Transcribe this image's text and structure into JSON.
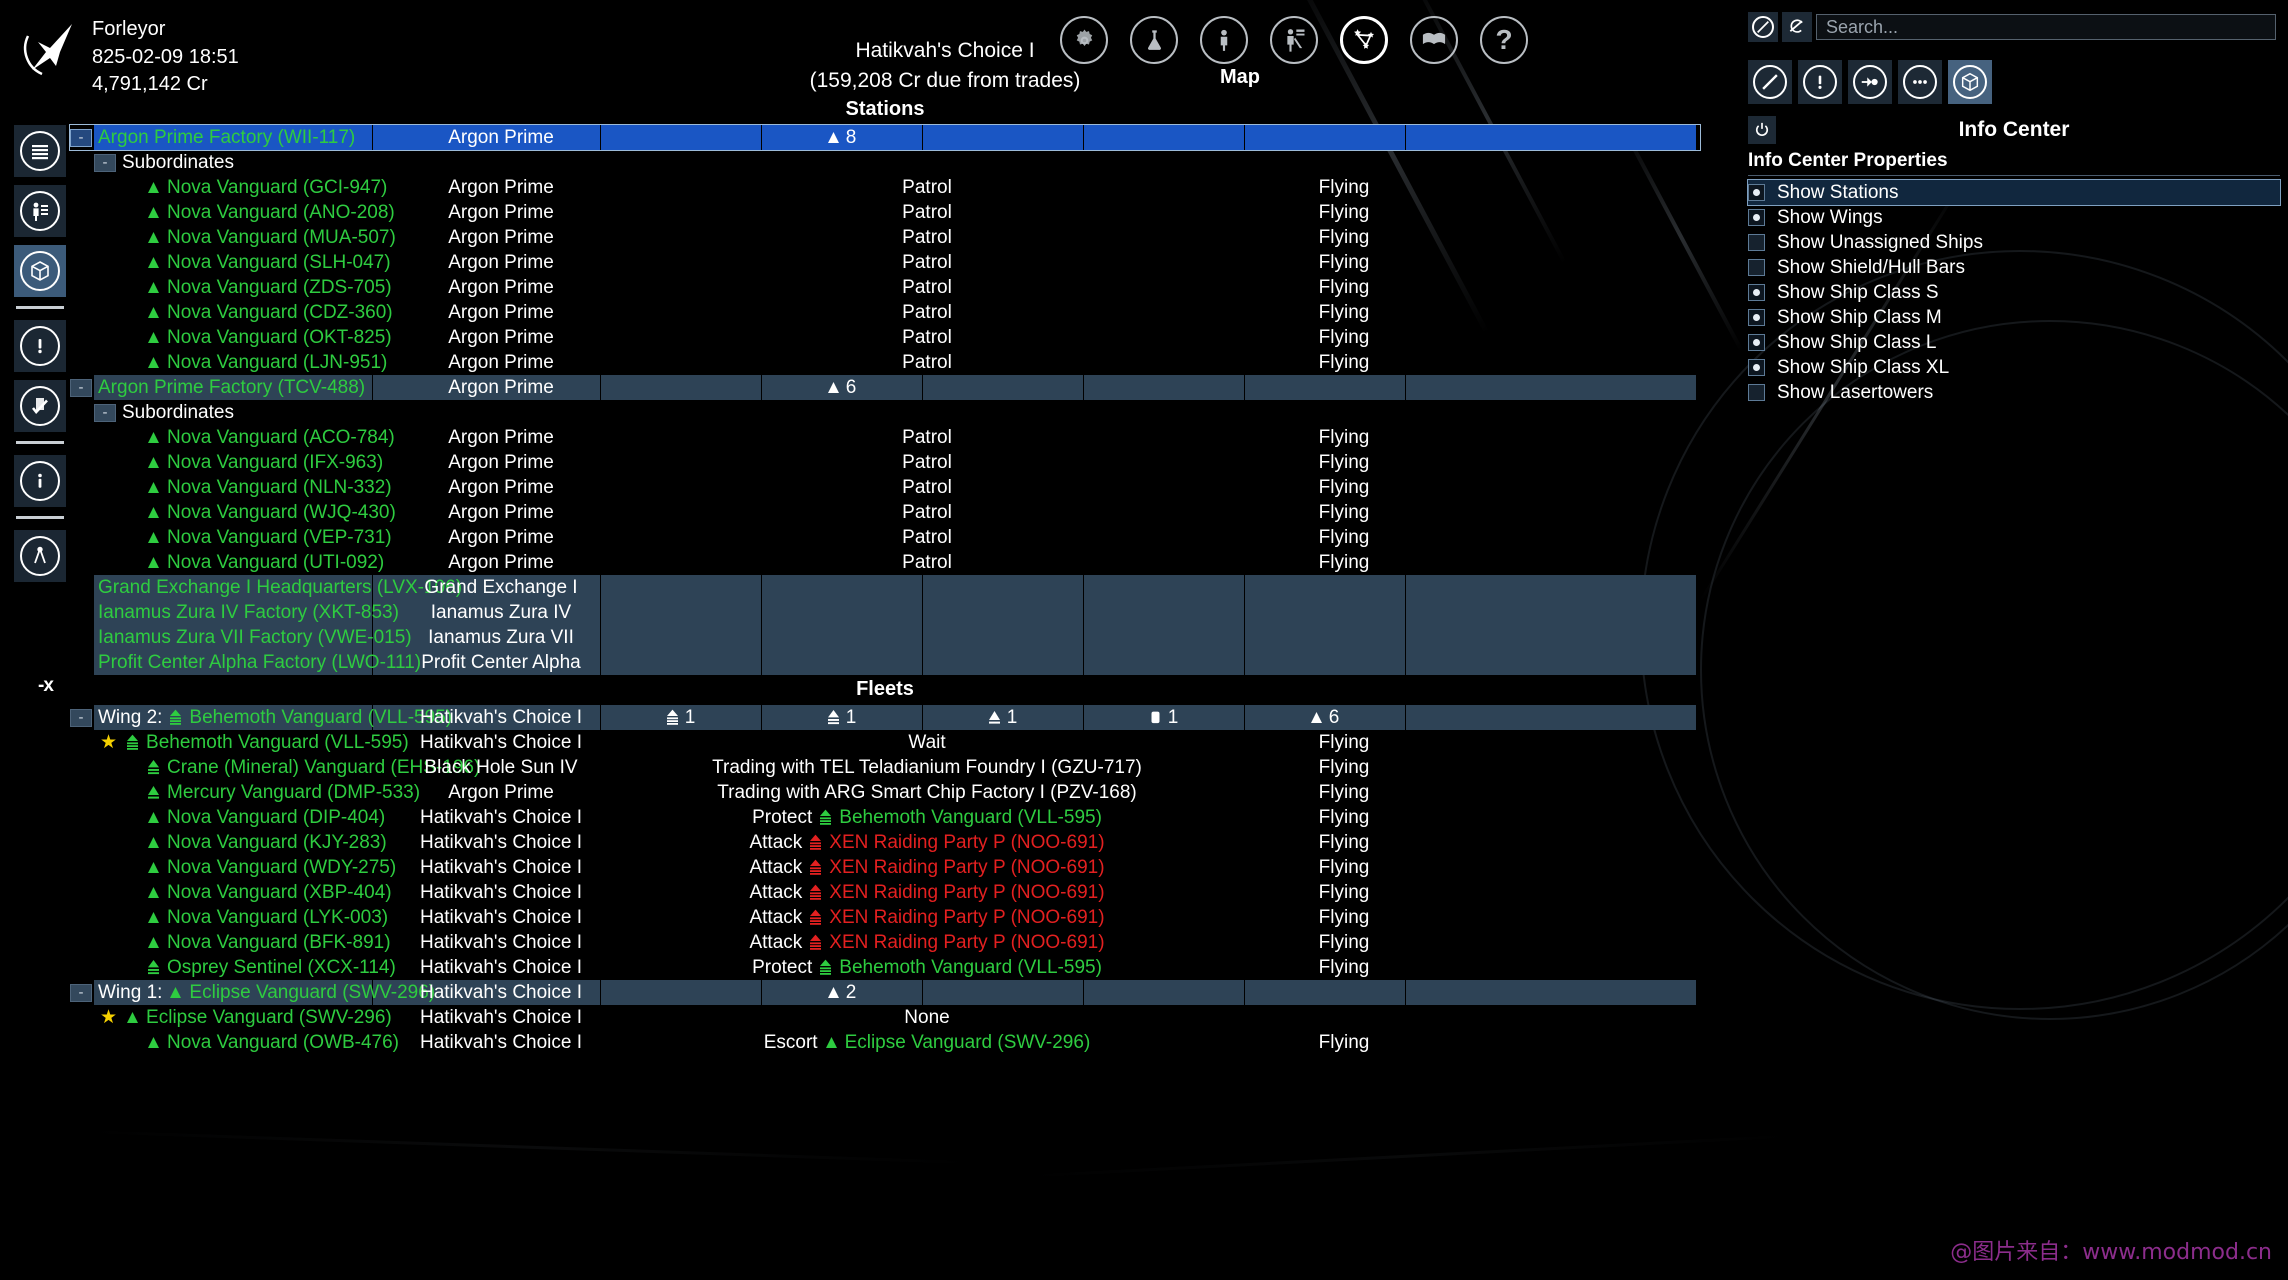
{
  "topbar": {
    "player_name": "Forleyor",
    "date": "825-02-09 18:51",
    "credits": "4,791,142 Cr",
    "sector_name": "Hatikvah's Choice I",
    "sector_sub": "(159,208 Cr due from trades)",
    "active_label": "Map",
    "icons": [
      {
        "name": "gear-icon",
        "label": "Settings",
        "active": false
      },
      {
        "name": "flask-icon",
        "label": "Research",
        "active": false
      },
      {
        "name": "person-icon",
        "label": "Player Info",
        "active": false
      },
      {
        "name": "crew-icon",
        "label": "Empire",
        "active": false
      },
      {
        "name": "map-constellation-icon",
        "label": "Map",
        "active": true
      },
      {
        "name": "book-icon",
        "label": "Encyclopedia",
        "active": false
      },
      {
        "name": "help-question-icon",
        "label": "Help",
        "active": false
      }
    ]
  },
  "left_rail": [
    {
      "name": "sidebar-item-object-list",
      "icon": "list-lines-icon",
      "active": false
    },
    {
      "name": "sidebar-item-personnel",
      "icon": "personnel-icon",
      "active": false
    },
    {
      "name": "sidebar-item-info-center",
      "icon": "cube-icon",
      "active": true
    },
    {
      "separator": true
    },
    {
      "name": "sidebar-item-alerts",
      "icon": "alert-exclamation-icon",
      "active": false
    },
    {
      "name": "sidebar-item-missions",
      "icon": "clipboard-check-icon",
      "active": false
    },
    {
      "separator": true
    },
    {
      "name": "sidebar-item-info",
      "icon": "info-i-icon",
      "active": false
    },
    {
      "separator": true
    },
    {
      "name": "sidebar-item-measure",
      "icon": "compass-divider-icon",
      "active": false
    }
  ],
  "table": {
    "stations_header": "Stations",
    "fleets_header": "Fleets",
    "close_tab_label": "-x",
    "subordinates_label": "Subordinates",
    "stations": [
      {
        "kind": "station",
        "expander": "-",
        "indent": 0,
        "name": "Argon Prime Factory (WII-117)",
        "sector": "Argon Prime",
        "counts": [
          {
            "icon": "ship-s-icon",
            "value": "8"
          }
        ],
        "count_col": 2,
        "order": "",
        "status": "",
        "style": "highlight"
      },
      {
        "kind": "group",
        "expander": "-",
        "indent": 1,
        "name": "Subordinates",
        "sector": "",
        "order": "",
        "status": "",
        "style": "plain"
      },
      {
        "kind": "ship",
        "indent": 2,
        "icon": "ship-s-icon",
        "name": "Nova Vanguard (GCI-947)",
        "sector": "Argon Prime",
        "order": "Patrol",
        "status": "Flying",
        "style": "plain"
      },
      {
        "kind": "ship",
        "indent": 2,
        "icon": "ship-s-icon",
        "name": "Nova Vanguard (ANO-208)",
        "sector": "Argon Prime",
        "order": "Patrol",
        "status": "Flying",
        "style": "plain"
      },
      {
        "kind": "ship",
        "indent": 2,
        "icon": "ship-s-icon",
        "name": "Nova Vanguard (MUA-507)",
        "sector": "Argon Prime",
        "order": "Patrol",
        "status": "Flying",
        "style": "plain"
      },
      {
        "kind": "ship",
        "indent": 2,
        "icon": "ship-s-icon",
        "name": "Nova Vanguard (SLH-047)",
        "sector": "Argon Prime",
        "order": "Patrol",
        "status": "Flying",
        "style": "plain"
      },
      {
        "kind": "ship",
        "indent": 2,
        "icon": "ship-s-icon",
        "name": "Nova Vanguard (ZDS-705)",
        "sector": "Argon Prime",
        "order": "Patrol",
        "status": "Flying",
        "style": "plain"
      },
      {
        "kind": "ship",
        "indent": 2,
        "icon": "ship-s-icon",
        "name": "Nova Vanguard (CDZ-360)",
        "sector": "Argon Prime",
        "order": "Patrol",
        "status": "Flying",
        "style": "plain"
      },
      {
        "kind": "ship",
        "indent": 2,
        "icon": "ship-s-icon",
        "name": "Nova Vanguard (OKT-825)",
        "sector": "Argon Prime",
        "order": "Patrol",
        "status": "Flying",
        "style": "plain"
      },
      {
        "kind": "ship",
        "indent": 2,
        "icon": "ship-s-icon",
        "name": "Nova Vanguard (LJN-951)",
        "sector": "Argon Prime",
        "order": "Patrol",
        "status": "Flying",
        "style": "plain"
      },
      {
        "kind": "station",
        "expander": "-",
        "indent": 0,
        "name": "Argon Prime Factory (TCV-488)",
        "sector": "Argon Prime",
        "counts": [
          {
            "icon": "ship-s-icon",
            "value": "6"
          }
        ],
        "count_col": 2,
        "order": "",
        "status": "",
        "style": "band"
      },
      {
        "kind": "group",
        "expander": "-",
        "indent": 1,
        "name": "Subordinates",
        "sector": "",
        "order": "",
        "status": "",
        "style": "plain"
      },
      {
        "kind": "ship",
        "indent": 2,
        "icon": "ship-s-icon",
        "name": "Nova Vanguard (ACO-784)",
        "sector": "Argon Prime",
        "order": "Patrol",
        "status": "Flying",
        "style": "plain"
      },
      {
        "kind": "ship",
        "indent": 2,
        "icon": "ship-s-icon",
        "name": "Nova Vanguard (IFX-963)",
        "sector": "Argon Prime",
        "order": "Patrol",
        "status": "Flying",
        "style": "plain"
      },
      {
        "kind": "ship",
        "indent": 2,
        "icon": "ship-s-icon",
        "name": "Nova Vanguard (NLN-332)",
        "sector": "Argon Prime",
        "order": "Patrol",
        "status": "Flying",
        "style": "plain"
      },
      {
        "kind": "ship",
        "indent": 2,
        "icon": "ship-s-icon",
        "name": "Nova Vanguard (WJQ-430)",
        "sector": "Argon Prime",
        "order": "Patrol",
        "status": "Flying",
        "style": "plain"
      },
      {
        "kind": "ship",
        "indent": 2,
        "icon": "ship-s-icon",
        "name": "Nova Vanguard (VEP-731)",
        "sector": "Argon Prime",
        "order": "Patrol",
        "status": "Flying",
        "style": "plain"
      },
      {
        "kind": "ship",
        "indent": 2,
        "icon": "ship-s-icon",
        "name": "Nova Vanguard (UTI-092)",
        "sector": "Argon Prime",
        "order": "Patrol",
        "status": "Flying",
        "style": "plain"
      },
      {
        "kind": "station",
        "indent": 0,
        "name": "Grand Exchange I Headquarters (LVX-106)",
        "sector": "Grand Exchange I",
        "order": "",
        "status": "",
        "style": "band"
      },
      {
        "kind": "station",
        "indent": 0,
        "name": "Ianamus Zura IV Factory (XKT-853)",
        "sector": "Ianamus Zura IV",
        "order": "",
        "status": "",
        "style": "band"
      },
      {
        "kind": "station",
        "indent": 0,
        "name": "Ianamus Zura VII Factory (VWE-015)",
        "sector": "Ianamus Zura VII",
        "order": "",
        "status": "",
        "style": "band"
      },
      {
        "kind": "station",
        "indent": 0,
        "name": "Profit Center Alpha Factory (LWO-111)",
        "sector": "Profit Center Alpha",
        "order": "",
        "status": "",
        "style": "band"
      }
    ],
    "fleets": [
      {
        "kind": "wing",
        "expander": "-",
        "indent": 0,
        "prefix": "Wing 2:",
        "icon": "ship-xl-icon",
        "name": "Behemoth Vanguard (VLL-595)",
        "sector": "Hatikvah's Choice I",
        "counts": [
          {
            "icon": "ship-xl-icon",
            "value": "1"
          },
          {
            "icon": "ship-l-icon",
            "value": "1"
          },
          {
            "icon": "ship-m-icon",
            "value": "1"
          },
          {
            "icon": "ship-station-icon",
            "value": "1"
          },
          {
            "icon": "ship-s-icon",
            "value": "6"
          }
        ],
        "order": "",
        "status": "",
        "style": "band"
      },
      {
        "kind": "ship",
        "indent": 1,
        "star": true,
        "icon": "ship-xl-icon",
        "name": "Behemoth Vanguard (VLL-595)",
        "sector": "Hatikvah's Choice I",
        "order": "Wait",
        "status": "Flying",
        "style": "plain"
      },
      {
        "kind": "ship",
        "indent": 2,
        "icon": "ship-l-icon",
        "name": "Crane (Mineral) Vanguard (EHS-196)",
        "sector": "Black Hole Sun IV",
        "order": "Trading with TEL Teladianium Foundry I (GZU-717)",
        "status": "Flying",
        "style": "plain"
      },
      {
        "kind": "ship",
        "indent": 2,
        "icon": "ship-m-icon",
        "name": "Mercury Vanguard (DMP-533)",
        "sector": "Argon Prime",
        "order": "Trading with ARG Smart Chip Factory I (PZV-168)",
        "status": "Flying",
        "style": "plain"
      },
      {
        "kind": "ship",
        "indent": 2,
        "icon": "ship-s-icon",
        "name": "Nova Vanguard (DIP-404)",
        "sector": "Hatikvah's Choice I",
        "order": "Protect",
        "order_target": "Behemoth Vanguard (VLL-595)",
        "order_target_icon": "ship-xl-icon",
        "order_target_color": "green",
        "status": "Flying",
        "style": "plain"
      },
      {
        "kind": "ship",
        "indent": 2,
        "icon": "ship-s-icon",
        "name": "Nova Vanguard (KJY-283)",
        "sector": "Hatikvah's Choice I",
        "order": "Attack",
        "order_target": "XEN Raiding Party P (NOO-691)",
        "order_target_icon": "ship-xl-icon",
        "order_target_color": "red",
        "status": "Flying",
        "style": "plain"
      },
      {
        "kind": "ship",
        "indent": 2,
        "icon": "ship-s-icon",
        "name": "Nova Vanguard (WDY-275)",
        "sector": "Hatikvah's Choice I",
        "order": "Attack",
        "order_target": "XEN Raiding Party P (NOO-691)",
        "order_target_icon": "ship-xl-icon",
        "order_target_color": "red",
        "status": "Flying",
        "style": "plain"
      },
      {
        "kind": "ship",
        "indent": 2,
        "icon": "ship-s-icon",
        "name": "Nova Vanguard (XBP-404)",
        "sector": "Hatikvah's Choice I",
        "order": "Attack",
        "order_target": "XEN Raiding Party P (NOO-691)",
        "order_target_icon": "ship-xl-icon",
        "order_target_color": "red",
        "status": "Flying",
        "style": "plain"
      },
      {
        "kind": "ship",
        "indent": 2,
        "icon": "ship-s-icon",
        "name": "Nova Vanguard (LYK-003)",
        "sector": "Hatikvah's Choice I",
        "order": "Attack",
        "order_target": "XEN Raiding Party P (NOO-691)",
        "order_target_icon": "ship-xl-icon",
        "order_target_color": "red",
        "status": "Flying",
        "style": "plain"
      },
      {
        "kind": "ship",
        "indent": 2,
        "icon": "ship-s-icon",
        "name": "Nova Vanguard (BFK-891)",
        "sector": "Hatikvah's Choice I",
        "order": "Attack",
        "order_target": "XEN Raiding Party P (NOO-691)",
        "order_target_icon": "ship-xl-icon",
        "order_target_color": "red",
        "status": "Flying",
        "style": "plain"
      },
      {
        "kind": "ship",
        "indent": 2,
        "icon": "ship-l-icon",
        "name": "Osprey Sentinel (XCX-114)",
        "sector": "Hatikvah's Choice I",
        "order": "Protect",
        "order_target": "Behemoth Vanguard (VLL-595)",
        "order_target_icon": "ship-xl-icon",
        "order_target_color": "green",
        "status": "Flying",
        "style": "plain"
      },
      {
        "kind": "wing",
        "expander": "-",
        "indent": 0,
        "prefix": "Wing 1:",
        "icon": "ship-s-icon",
        "name": "Eclipse Vanguard (SWV-296)",
        "sector": "Hatikvah's Choice I",
        "counts": [
          {
            "icon": "ship-s-icon",
            "value": "2"
          }
        ],
        "count_col": 2,
        "order": "",
        "status": "",
        "style": "band"
      },
      {
        "kind": "ship",
        "indent": 1,
        "star": true,
        "icon": "ship-s-icon",
        "name": "Eclipse Vanguard (SWV-296)",
        "sector": "Hatikvah's Choice I",
        "order": "None",
        "status": "",
        "style": "plain"
      },
      {
        "kind": "ship",
        "indent": 2,
        "icon": "ship-s-icon",
        "name": "Nova Vanguard (OWB-476)",
        "sector": "Hatikvah's Choice I",
        "order": "Escort",
        "order_target": "Eclipse Vanguard (SWV-296)",
        "order_target_icon": "ship-s-icon",
        "order_target_color": "green",
        "status": "Flying",
        "style": "plain"
      }
    ]
  },
  "right_panel": {
    "search_placeholder": "Search...",
    "title": "Info Center",
    "subtitle": "Info Center Properties",
    "search_buttons": [
      {
        "name": "filter-off-icon"
      },
      {
        "name": "filter-reset-icon"
      }
    ],
    "tool_buttons": [
      {
        "name": "no-filter-icon",
        "active": false
      },
      {
        "name": "alert-exclamation-icon",
        "active": false
      },
      {
        "name": "target-cursor-icon",
        "active": false
      },
      {
        "name": "more-options-icon",
        "active": false
      },
      {
        "name": "cube-icon",
        "active": true
      }
    ],
    "power_button": {
      "name": "power-icon"
    },
    "properties": [
      {
        "label": "Show Stations",
        "checked": true,
        "selected": true
      },
      {
        "label": "Show Wings",
        "checked": true,
        "selected": false
      },
      {
        "label": "Show Unassigned Ships",
        "checked": false,
        "selected": false
      },
      {
        "label": "Show Shield/Hull Bars",
        "checked": false,
        "selected": false
      },
      {
        "label": "Show Ship Class S",
        "checked": true,
        "selected": false
      },
      {
        "label": "Show Ship Class M",
        "checked": true,
        "selected": false
      },
      {
        "label": "Show Ship Class L",
        "checked": true,
        "selected": false
      },
      {
        "label": "Show Ship Class XL",
        "checked": true,
        "selected": false
      },
      {
        "label": "Show Lasertowers",
        "checked": false,
        "selected": false
      }
    ]
  },
  "watermark": "@图片来自：www.modmod.cn",
  "colors": {
    "highlight_blue": "#1a56c4",
    "band_slate": "#2e4356",
    "green": "#2ecc40",
    "red": "#e32020",
    "star_yellow": "#f5d000"
  }
}
